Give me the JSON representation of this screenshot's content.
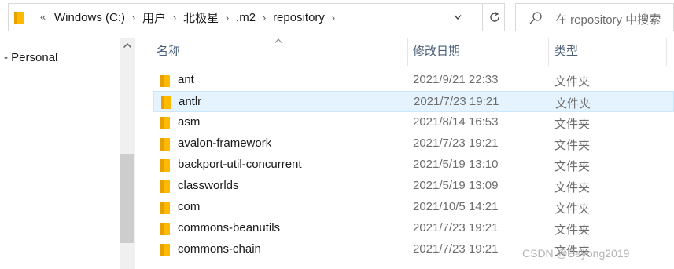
{
  "address_bar": {
    "overflow_glyph": "«",
    "crumbs": [
      "Windows (C:)",
      "用户",
      "北极星",
      ".m2",
      "repository"
    ],
    "separator": "›"
  },
  "search": {
    "placeholder": "在 repository 中搜索"
  },
  "nav": {
    "items": [
      {
        "label": "- Personal"
      }
    ]
  },
  "columns": {
    "name": "名称",
    "date": "修改日期",
    "type": "类型"
  },
  "rows": [
    {
      "name": "ant",
      "date": "2021/9/21 22:33",
      "type": "文件夹",
      "selected": false
    },
    {
      "name": "antlr",
      "date": "2021/7/23 19:21",
      "type": "文件夹",
      "selected": true
    },
    {
      "name": "asm",
      "date": "2021/8/14 16:53",
      "type": "文件夹",
      "selected": false
    },
    {
      "name": "avalon-framework",
      "date": "2021/7/23 19:21",
      "type": "文件夹",
      "selected": false
    },
    {
      "name": "backport-util-concurrent",
      "date": "2021/5/19 13:10",
      "type": "文件夹",
      "selected": false
    },
    {
      "name": "classworlds",
      "date": "2021/5/19 13:09",
      "type": "文件夹",
      "selected": false
    },
    {
      "name": "com",
      "date": "2021/10/5 14:21",
      "type": "文件夹",
      "selected": false
    },
    {
      "name": "commons-beanutils",
      "date": "2021/7/23 19:21",
      "type": "文件夹",
      "selected": false
    },
    {
      "name": "commons-chain",
      "date": "2021/7/23 19:21",
      "type": "文件夹",
      "selected": false
    }
  ],
  "watermark": "CSDN @Beyong2019",
  "colors": {
    "folder": "#ffb900",
    "folder_dark": "#e6a100",
    "selection": "#e5f3ff",
    "header_text": "#4c607a"
  }
}
